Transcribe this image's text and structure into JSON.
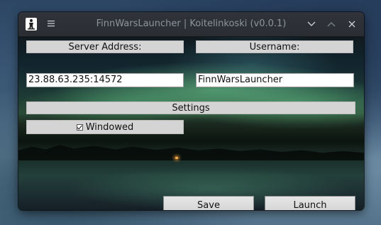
{
  "window": {
    "title": "FinnWarsLauncher | Koitelinkoski (v0.0.1)"
  },
  "titlebar": {
    "app_icon": "person-figure-icon",
    "menu_icon": "hamburger-menu-icon",
    "minimize_icon": "chevron-down-icon",
    "maximize_icon": "chevron-up-icon",
    "close_icon": "close-icon"
  },
  "form": {
    "server_address_label": "Server Address:",
    "server_address_value": "23.88.63.235:14572",
    "username_label": "Username:",
    "username_value": "FinnWarsLauncher",
    "settings_label": "Settings",
    "windowed_label": "Windowed",
    "windowed_checked": true
  },
  "buttons": {
    "save_label": "Save",
    "launch_label": "Launch"
  },
  "colors": {
    "titlebar_bg": "#2c3035",
    "label_bg": "#d4d4d4",
    "input_bg": "#ffffff",
    "button_bg": "#dcdcdc"
  }
}
